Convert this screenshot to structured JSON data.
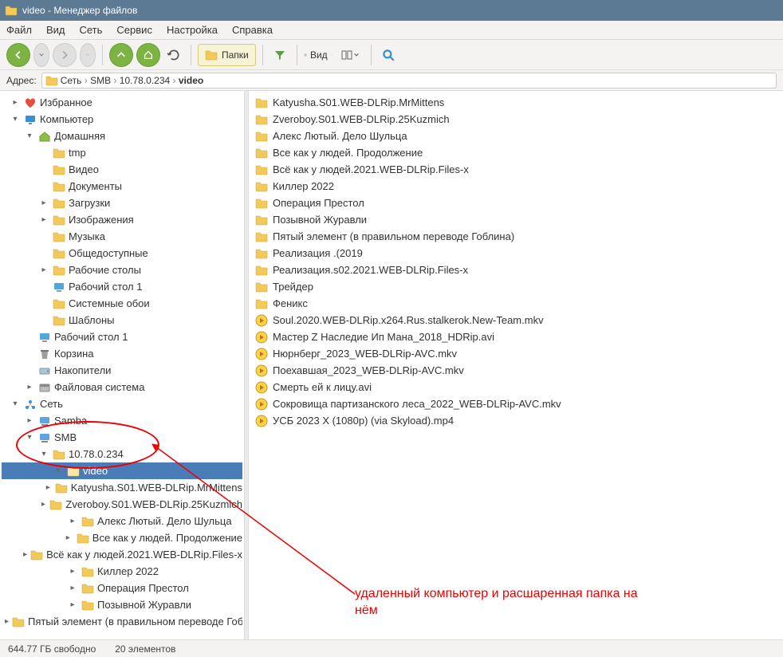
{
  "title": "video - Менеджер файлов",
  "menu": [
    "Файл",
    "Вид",
    "Сеть",
    "Сервис",
    "Настройка",
    "Справка"
  ],
  "toolbar": {
    "folders_label": "Папки",
    "view_label": "Вид"
  },
  "address": {
    "label": "Адрес:",
    "crumbs": [
      "Сеть",
      "SMB",
      "10.78.0.234",
      "video"
    ]
  },
  "tree": [
    {
      "d": 0,
      "exp": ">",
      "icon": "heart",
      "label": "Избранное"
    },
    {
      "d": 0,
      "exp": "v",
      "icon": "monitor",
      "label": "Компьютер"
    },
    {
      "d": 1,
      "exp": "v",
      "icon": "home",
      "label": "Домашняя"
    },
    {
      "d": 2,
      "exp": "",
      "icon": "folder",
      "label": "tmp"
    },
    {
      "d": 2,
      "exp": "",
      "icon": "videos",
      "label": "Видео"
    },
    {
      "d": 2,
      "exp": "",
      "icon": "docs",
      "label": "Документы"
    },
    {
      "d": 2,
      "exp": ">",
      "icon": "downloads",
      "label": "Загрузки"
    },
    {
      "d": 2,
      "exp": ">",
      "icon": "images",
      "label": "Изображения"
    },
    {
      "d": 2,
      "exp": "",
      "icon": "music",
      "label": "Музыка"
    },
    {
      "d": 2,
      "exp": "",
      "icon": "public",
      "label": "Общедоступные"
    },
    {
      "d": 2,
      "exp": ">",
      "icon": "desktops",
      "label": "Рабочие столы"
    },
    {
      "d": 2,
      "exp": "",
      "icon": "desktop",
      "label": "Рабочий стол 1"
    },
    {
      "d": 2,
      "exp": "",
      "icon": "wallpaper",
      "label": "Системные обои"
    },
    {
      "d": 2,
      "exp": "",
      "icon": "templates",
      "label": "Шаблоны"
    },
    {
      "d": 1,
      "exp": "",
      "icon": "desktop",
      "label": "Рабочий стол 1"
    },
    {
      "d": 1,
      "exp": "",
      "icon": "trash",
      "label": "Корзина"
    },
    {
      "d": 1,
      "exp": "",
      "icon": "devices",
      "label": "Накопители"
    },
    {
      "d": 1,
      "exp": ">",
      "icon": "filesystem",
      "label": "Файловая система"
    },
    {
      "d": 0,
      "exp": "v",
      "icon": "network",
      "label": "Сеть"
    },
    {
      "d": 1,
      "exp": ">",
      "icon": "samba",
      "label": "Samba"
    },
    {
      "d": 1,
      "exp": "v",
      "icon": "samba",
      "label": "SMB"
    },
    {
      "d": 2,
      "exp": "v",
      "icon": "folder",
      "label": "10.78.0.234"
    },
    {
      "d": 3,
      "exp": "v",
      "icon": "folder",
      "label": "video",
      "selected": true
    },
    {
      "d": 4,
      "exp": ">",
      "icon": "folder",
      "label": "Katyusha.S01.WEB-DLRip.MrMittens"
    },
    {
      "d": 4,
      "exp": ">",
      "icon": "folder",
      "label": "Zveroboy.S01.WEB-DLRip.25Kuzmich"
    },
    {
      "d": 4,
      "exp": ">",
      "icon": "folder",
      "label": "Алекс Лютый. Дело Шульца"
    },
    {
      "d": 4,
      "exp": ">",
      "icon": "folder",
      "label": "Все как у людей. Продолжение"
    },
    {
      "d": 4,
      "exp": ">",
      "icon": "folder",
      "label": "Всё как у людей.2021.WEB-DLRip.Files-x"
    },
    {
      "d": 4,
      "exp": ">",
      "icon": "folder",
      "label": "Киллер 2022"
    },
    {
      "d": 4,
      "exp": ">",
      "icon": "folder",
      "label": "Операция Престол"
    },
    {
      "d": 4,
      "exp": ">",
      "icon": "folder",
      "label": "Позывной Журавли"
    },
    {
      "d": 4,
      "exp": ">",
      "icon": "folder",
      "label": "Пятый элемент (в правильном переводе Гоблина)"
    }
  ],
  "files": [
    {
      "t": "folder",
      "n": "Katyusha.S01.WEB-DLRip.MrMittens"
    },
    {
      "t": "folder",
      "n": "Zveroboy.S01.WEB-DLRip.25Kuzmich"
    },
    {
      "t": "folder",
      "n": "Алекс Лютый. Дело Шульца"
    },
    {
      "t": "folder",
      "n": "Все как у людей. Продолжение"
    },
    {
      "t": "folder",
      "n": "Всё как у людей.2021.WEB-DLRip.Files-x"
    },
    {
      "t": "folder",
      "n": "Киллер 2022"
    },
    {
      "t": "folder",
      "n": "Операция Престол"
    },
    {
      "t": "folder",
      "n": "Позывной Журавли"
    },
    {
      "t": "folder",
      "n": "Пятый элемент (в правильном переводе Гоблина)"
    },
    {
      "t": "folder",
      "n": "Реализация .(2019"
    },
    {
      "t": "folder",
      "n": "Реализация.s02.2021.WEB-DLRip.Files-x"
    },
    {
      "t": "folder",
      "n": "Трейдер"
    },
    {
      "t": "folder",
      "n": "Феникс"
    },
    {
      "t": "video",
      "n": "Soul.2020.WEB-DLRip.x264.Rus.stalkerok.New-Team.mkv"
    },
    {
      "t": "video",
      "n": "Мастер Z Наследие Ип Мана_2018_HDRip.avi"
    },
    {
      "t": "video",
      "n": "Нюрнберг_2023_WEB-DLRip-AVC.mkv"
    },
    {
      "t": "video",
      "n": "Поехавшая_2023_WEB-DLRip-AVC.mkv"
    },
    {
      "t": "video",
      "n": "Смерть ей к лицу.avi"
    },
    {
      "t": "video",
      "n": "Сокровища партизанского леса_2022_WEB-DLRip-AVC.mkv"
    },
    {
      "t": "video",
      "n": "УСБ 2023 X (1080p) (via Skyload).mp4"
    }
  ],
  "status": {
    "free": "644.77 ГБ свободно",
    "count": "20 элементов"
  },
  "annotation": "удаленный компьютер и расшаренная папка на нём"
}
